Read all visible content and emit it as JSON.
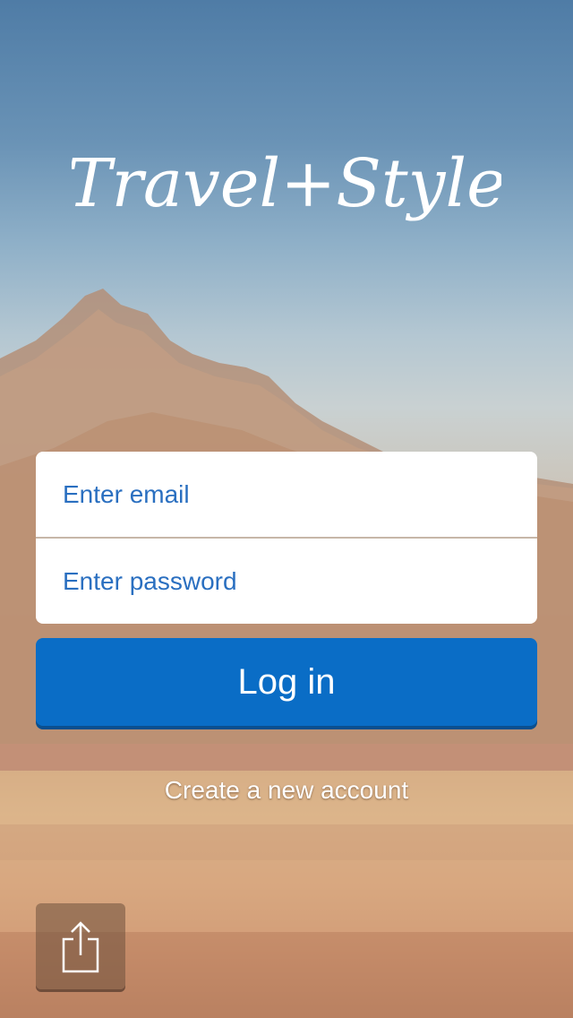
{
  "app": {
    "brand": "Travel+Style"
  },
  "login_form": {
    "email_placeholder": "Enter email",
    "password_placeholder": "Enter password",
    "login_label": "Log in",
    "create_account_label": "Create a new account"
  },
  "toolbar": {
    "share_icon": "share-icon"
  },
  "colors": {
    "primary_button": "#0a6dc6",
    "input_text": "#2a6fc0",
    "card_background": "#ffffff"
  }
}
